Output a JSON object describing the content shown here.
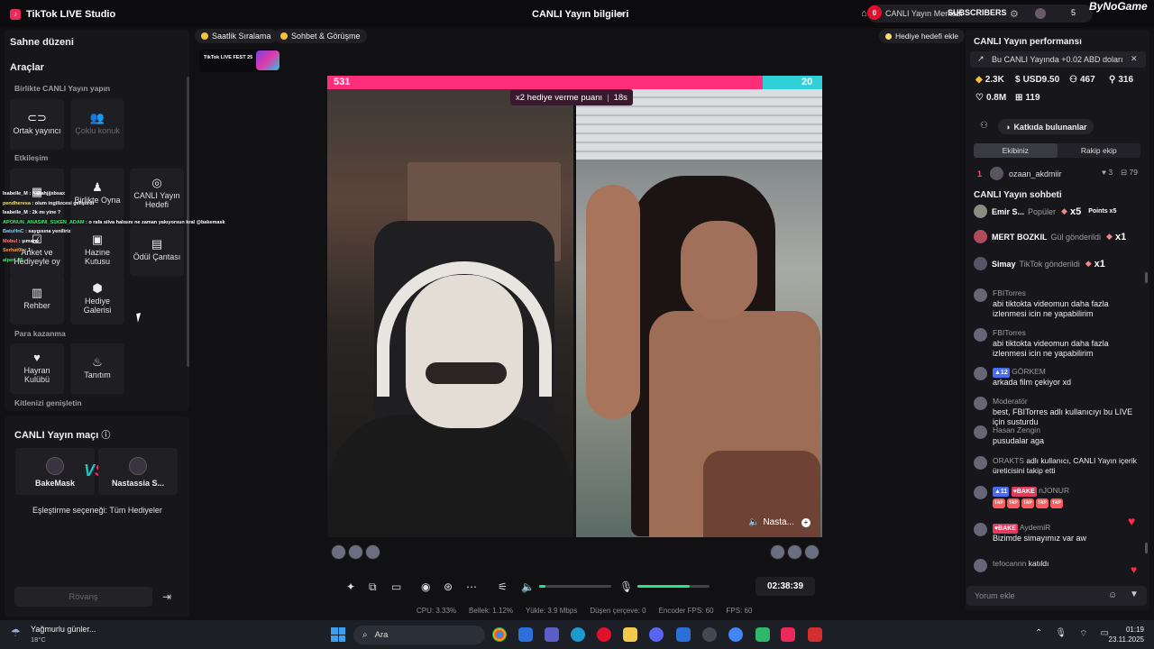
{
  "titlebar": {
    "app_name": "TikTok LIVE Studio",
    "center_title": "CANLI Yayın bilgileri",
    "notif_count": "0",
    "live_center": "CANLI Yayın Merkezi",
    "subscribers": "SUBSCRIBERS",
    "count": "5",
    "brand": "ByNoGame"
  },
  "left": {
    "scene_title": "Sahne düzeni",
    "tools_title": "Araçlar",
    "section_together": "Birlikte CANLI Yayın yapın",
    "tile_cohost": "Ortak yayıncı",
    "tile_multiguest": "Çoklu konuk",
    "section_interaction": "Etkileşim",
    "tile_play_together": "Birlikte Oyna",
    "tile_live_goal_l1": "CANLI Yayın",
    "tile_live_goal_l2": "Hedefi",
    "tile_poll_l1": "Anket ve",
    "tile_poll_l2": "Hediyeyle oy",
    "tile_gift_box_l1": "Hazine",
    "tile_gift_box_l2": "Kutusu",
    "tile_reward_bag": "Ödül Çantası",
    "tile_guide": "Rehber",
    "tile_gift_gallery_l1": "Hediye",
    "tile_gift_gallery_l2": "Galerisi",
    "section_monetize": "Para kazanma",
    "tile_fan_club_l1": "Hayran",
    "tile_fan_club_l2": "Kulübü",
    "tile_promote": "Tanıtım",
    "section_expand": "Kitlenizi genişletin",
    "match_title": "CANLI Yayın maçı",
    "match_p1": "BakeMask",
    "match_p2": "Nastassia S...",
    "match_option": "Eşleştirme seçeneği: Tüm Hediyeler",
    "rematch": "Rövanş"
  },
  "overlay_chat": [
    {
      "name": "Isabelle_M",
      "text": ": hahahjjjxbsax",
      "color": "#ffffff"
    },
    {
      "name": "pendheresa",
      "text": ": olum ingilizcesi geliştirdi",
      "color": "#f5e070"
    },
    {
      "name": "Isabelle_M",
      "text": ": 2k mı yine ?",
      "color": "#ffffff"
    },
    {
      "name": "APONUN_ANASINI_S1KEN_ADAM",
      "text": ": o rafa silva halısını ne zaman yakıyorsun kral @bakemask",
      "color": "#3ee86a"
    },
    {
      "name": "BatuHnC",
      "text": ": saygısına yeniliriz",
      "color": "#7fd0ff"
    },
    {
      "name": "Mobul",
      "text": ": şımardı",
      "color": "#ff7a7a"
    },
    {
      "name": "Serhat0k",
      "text": ": 1",
      "color": "#f5a23d"
    },
    {
      "name": "alper_06",
      "text": "",
      "color": "#3ee86a"
    }
  ],
  "center": {
    "pill_hourly": "Saatlik Sıralama",
    "pill_chat": "Sohbet & Görüşme",
    "fest_label": "TikTok LIVE FEST 25",
    "gift_goal": "Hediye hedefi ekle",
    "score_left": "531",
    "score_right": "20",
    "multiplier": "x2 hediye verme puanı",
    "multiplier_time": "18s",
    "opponent_label": "Nasta...",
    "timer": "02:38:39",
    "stats": {
      "cpu": "CPU: 3.33%",
      "memory": "Bellek: 1.12%",
      "upload": "Yükle: 3.9 Mbps",
      "dropped": "Düşen çerçeve: 0",
      "encoder_fps": "Encoder FPS: 60",
      "fps": "FPS: 60"
    },
    "volume_level": 0.09,
    "mic_level": 0.73
  },
  "right": {
    "perf_title": "CANLI Yayın performansı",
    "notice": "Bu CANLI Yayında +0.02 ABD doları",
    "coins": "2.3K",
    "usd": "USD9.50",
    "viewers": "467",
    "followers": "316",
    "likes": "0.8M",
    "shares": "119",
    "contributors_btn": "Katkıda bulunanlar",
    "tab_ours": "Ekibiniz",
    "tab_rival": "Rakip ekip",
    "rank1_num": "1",
    "rank1_name": "ozaan_akdmiir",
    "rank1_likes": "3",
    "rank1_gifts": "79",
    "chat_title": "CANLI Yayın sohbeti",
    "gift_rows": [
      {
        "name": "Emir S...",
        "action": "Popüler",
        "qty": "x5",
        "extra": "Points x5"
      },
      {
        "name": "MERT BOZKIL",
        "action": "Gül gönderildi",
        "qty": "x1",
        "extra": ""
      },
      {
        "name": "Simay",
        "action": "TikTok gönderildi",
        "qty": "x1",
        "extra": ""
      }
    ],
    "messages": [
      {
        "name": "FBITorres",
        "text": "abi tiktokta videomun daha fazla izlenmesi icin ne yapabilirim"
      },
      {
        "name": "FBITorres",
        "text": "abi tiktokta videomun daha fazla izlenmesi icin ne yapabilirim"
      },
      {
        "name": "GÖRKEM",
        "level": "12",
        "text": "arkada film çekiyor xd"
      },
      {
        "name": "Moderatör",
        "text": "best, FBITorres adlı kullanıcıyı bu LIVE için susturdu"
      },
      {
        "name": "Hasan Zengin",
        "text": "pusudalar aga"
      },
      {
        "name": "ORAKTS",
        "text": "adlı kullanıcı, CANLI Yayın içerik üreticisini takip etti"
      },
      {
        "name": "nJONUR",
        "level": "11",
        "badge": "BAKE",
        "text": ""
      },
      {
        "name": "AydemiR",
        "badge": "BAKE",
        "text": "Bizimde simayımız var aw"
      },
      {
        "name": "tefocannn",
        "text": "katıldı"
      }
    ],
    "comment_placeholder": "Yorum ekle"
  },
  "taskbar": {
    "weather": "Yağmurlu günler...",
    "temp": "18°C",
    "search": "Ara",
    "time": "01:19",
    "date": "23.11.2025"
  }
}
